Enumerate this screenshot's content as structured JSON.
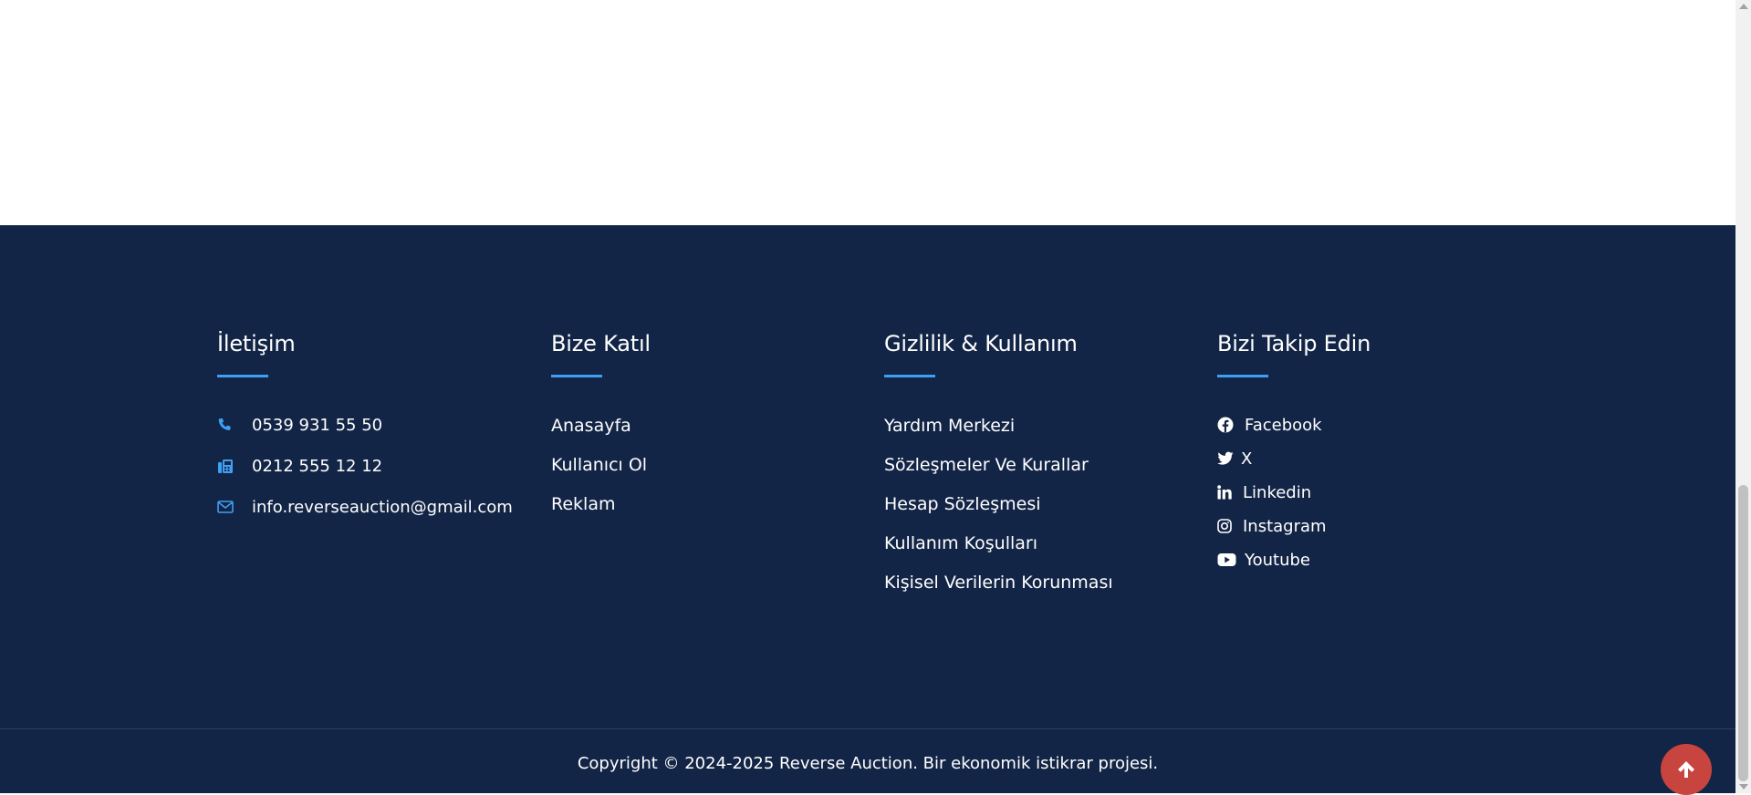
{
  "colors": {
    "footer_bg": "#132546",
    "accent": "#3ea0f2",
    "scroll_top_bg": "#c8443f",
    "text": "#ffffff"
  },
  "contact": {
    "title": "İletişim",
    "items": [
      {
        "icon": "phone-icon",
        "text": "0539 931 55 50"
      },
      {
        "icon": "fax-icon",
        "text": "0212 555 12 12"
      },
      {
        "icon": "envelope-icon",
        "text": "info.reverseauction@gmail.com"
      }
    ]
  },
  "join": {
    "title": "Bize Katıl",
    "links": [
      "Anasayfa",
      "Kullanıcı Ol",
      "Reklam"
    ]
  },
  "privacy": {
    "title": "Gizlilik & Kullanım",
    "links": [
      "Yardım Merkezi",
      "Sözleşmeler Ve Kurallar",
      "Hesap Sözleşmesi",
      "Kullanım Koşulları",
      "Kişisel Verilerin Korunması"
    ]
  },
  "follow": {
    "title": "Bizi Takip Edin",
    "items": [
      {
        "icon": "facebook-icon",
        "text": "Facebook"
      },
      {
        "icon": "twitter-icon",
        "text": "X"
      },
      {
        "icon": "linkedin-icon",
        "text": "Linkedin"
      },
      {
        "icon": "instagram-icon",
        "text": "Instagram"
      },
      {
        "icon": "youtube-icon",
        "text": "Youtube"
      }
    ]
  },
  "copyright": "Copyright © 2024-2025 Reverse Auction. Bir ekonomik istikrar projesi.",
  "scroll_top_icon": "arrow-up-icon"
}
